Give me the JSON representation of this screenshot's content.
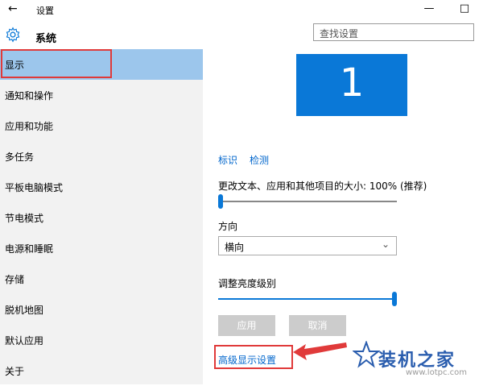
{
  "window": {
    "title": "设置",
    "back_icon": "back-arrow-icon",
    "minimize_icon": "minimize-icon",
    "maximize_icon": "maximize-icon"
  },
  "header": {
    "section_icon": "gear-icon",
    "section_title": "系统",
    "search_placeholder": "查找设置"
  },
  "sidebar": {
    "items": [
      {
        "label": "显示",
        "active": true
      },
      {
        "label": "通知和操作"
      },
      {
        "label": "应用和功能"
      },
      {
        "label": "多任务"
      },
      {
        "label": "平板电脑模式"
      },
      {
        "label": "节电模式"
      },
      {
        "label": "电源和睡眠"
      },
      {
        "label": "存储"
      },
      {
        "label": "脱机地图"
      },
      {
        "label": "默认应用"
      },
      {
        "label": "关于"
      }
    ]
  },
  "main": {
    "monitor_number": "1",
    "identify_link": "标识",
    "detect_link": "检测",
    "scale_label": "更改文本、应用和其他项目的大小: 100% (推荐)",
    "scale_value": 0,
    "orientation_label": "方向",
    "orientation_value": "横向",
    "brightness_label": "调整亮度级别",
    "brightness_value": 1.0,
    "apply_button": "应用",
    "cancel_button": "取消",
    "advanced_link": "高级显示设置"
  },
  "watermark": {
    "text": "装机之家",
    "url": "www.lotpc.com"
  },
  "colors": {
    "accent": "#0a78d7",
    "sidebar_active": "#9cc6ec",
    "highlight": "#e03a3a"
  }
}
